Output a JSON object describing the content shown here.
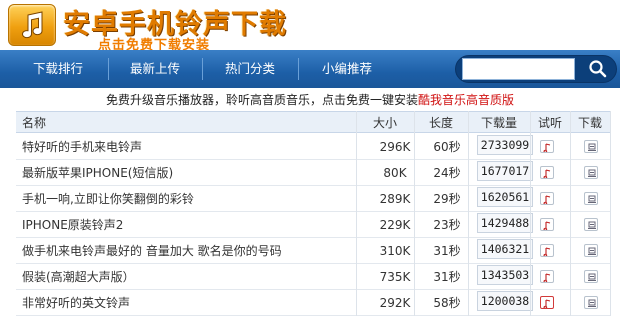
{
  "header": {
    "title": "安卓手机铃声下载",
    "subtitle": "点击免费下载安装",
    "logo_icon": "music-note-icon"
  },
  "nav": {
    "items": [
      {
        "label": "下载排行"
      },
      {
        "label": "最新上传"
      },
      {
        "label": "热门分类"
      },
      {
        "label": "小编推荐"
      }
    ],
    "search": {
      "value": "",
      "icon": "search-icon"
    }
  },
  "promo": {
    "text": "免费升级音乐播放器，聆听高音质音乐，点击免费一键安装",
    "link": "酷我音乐高音质版"
  },
  "table": {
    "columns": {
      "name": "名称",
      "size": "大小",
      "length": "长度",
      "downloads": "下载量",
      "listen": "试听",
      "download": "下载"
    },
    "rows": [
      {
        "name": "特好听的手机来电铃声",
        "size": "296K",
        "length": "60秒",
        "downloads": "2733099"
      },
      {
        "name": "最新版苹果IPHONE(短信版)",
        "size": "80K",
        "length": "24秒",
        "downloads": "1677017"
      },
      {
        "name": "手机一响,立即让你笑翻倒的彩铃",
        "size": "289K",
        "length": "29秒",
        "downloads": "1620561"
      },
      {
        "name": "IPHONE原装铃声2",
        "size": "229K",
        "length": "23秒",
        "downloads": "1429488"
      },
      {
        "name": "做手机来电铃声最好的 音量加大 歌名是你的号码",
        "size": "310K",
        "length": "31秒",
        "downloads": "1406321"
      },
      {
        "name": "假装(高潮超大声版）",
        "size": "735K",
        "length": "31秒",
        "downloads": "1343503"
      },
      {
        "name": "非常好听的英文铃声",
        "size": "292K",
        "length": "58秒",
        "downloads": "1200038"
      }
    ]
  },
  "colors": {
    "nav_bg": "#1d5fa7",
    "title_orange": "#e07b00",
    "promo_link_red": "#d01010",
    "header_row_bg": "#e9f0f8"
  }
}
